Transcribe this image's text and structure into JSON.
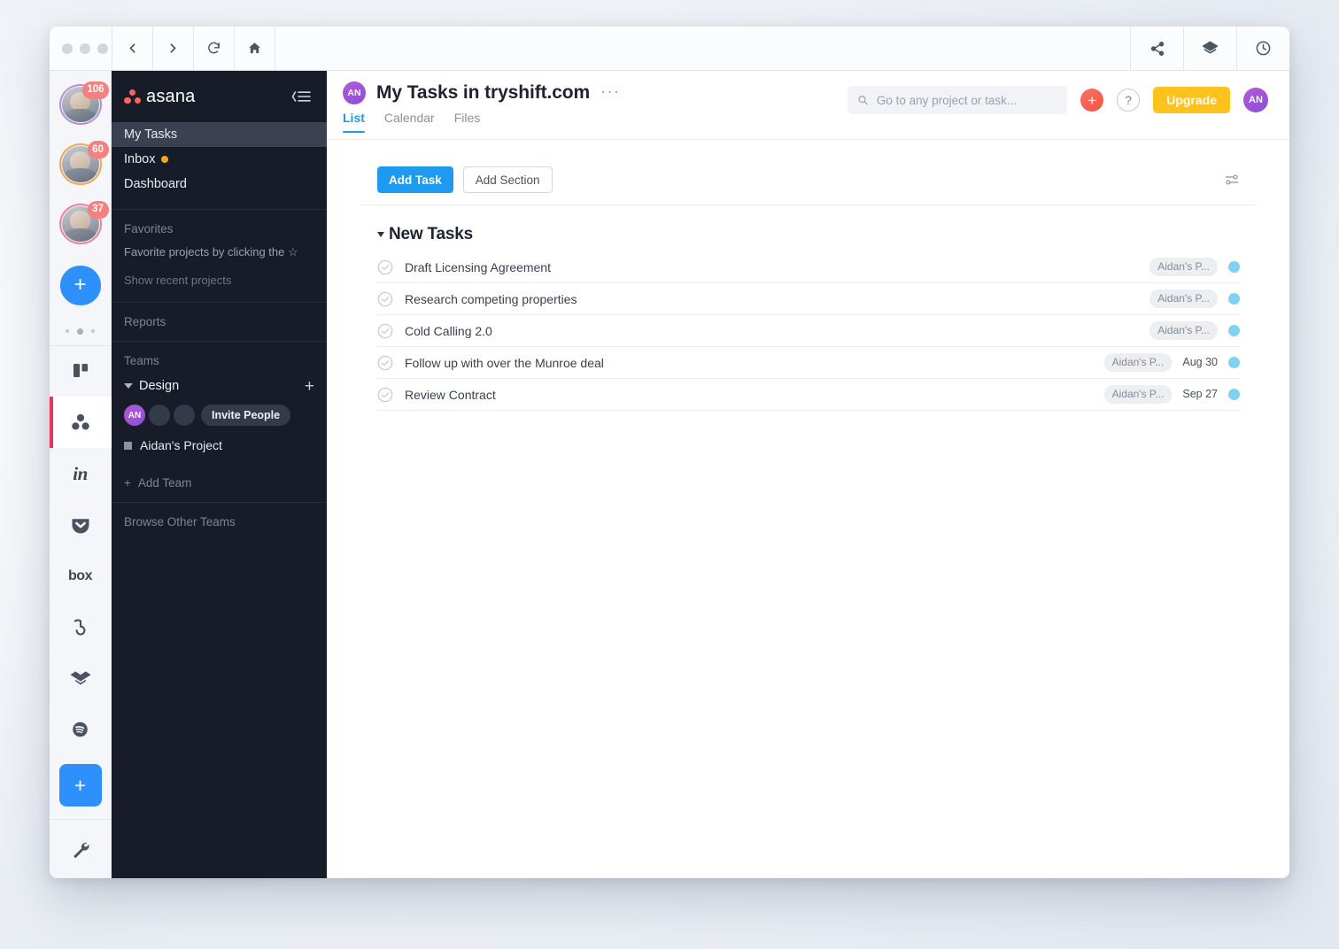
{
  "window": {
    "traffic_lights": [
      "close",
      "minimize",
      "maximize"
    ],
    "nav": [
      {
        "name": "back",
        "icon": "chevron-left-icon"
      },
      {
        "name": "forward",
        "icon": "chevron-right-icon"
      },
      {
        "name": "reload",
        "icon": "reload-icon"
      },
      {
        "name": "home",
        "icon": "home-icon"
      }
    ],
    "actions": [
      {
        "name": "share",
        "icon": "share-icon"
      },
      {
        "name": "layers",
        "icon": "layers-icon"
      },
      {
        "name": "history",
        "icon": "clock-icon"
      }
    ]
  },
  "rail": {
    "accounts": [
      {
        "badge": "106",
        "ring": "#b48fe0"
      },
      {
        "badge": "60",
        "ring": "#f0a85a"
      },
      {
        "badge": "37",
        "ring": "#ef7f9e"
      }
    ],
    "add_account_label": "+",
    "page_dots": 3,
    "apps": [
      {
        "name": "trello",
        "label": ""
      },
      {
        "name": "asana",
        "label": "",
        "active": true
      },
      {
        "name": "invision",
        "label": "in"
      },
      {
        "name": "pocket",
        "label": ""
      },
      {
        "name": "box",
        "label": "box"
      },
      {
        "name": "bitly",
        "label": ""
      },
      {
        "name": "dropbox",
        "label": ""
      },
      {
        "name": "spotify",
        "label": ""
      }
    ],
    "add_app_label": "+",
    "settings_icon": "wrench-icon"
  },
  "sidebar": {
    "logo_text": "asana",
    "collapse_icon": "collapse-menu-icon",
    "nav": [
      {
        "label": "My Tasks",
        "selected": true,
        "dot": false
      },
      {
        "label": "Inbox",
        "selected": false,
        "dot": true
      },
      {
        "label": "Dashboard",
        "selected": false,
        "dot": false
      }
    ],
    "favorites": {
      "caption": "Favorites",
      "empty_text": "Favorite projects by clicking the ",
      "star_glyph": "☆",
      "show_recent": "Show recent projects"
    },
    "reports_caption": "Reports",
    "teams": {
      "caption": "Teams",
      "team_name": "Design",
      "add_project_glyph": "+",
      "members": [
        {
          "initials": "AN",
          "me": true
        },
        {
          "initials": "",
          "me": false
        },
        {
          "initials": "",
          "me": false
        }
      ],
      "invite_label": "Invite People",
      "projects": [
        {
          "label": "Aidan's Project"
        }
      ],
      "add_team_label": "Add Team",
      "add_team_glyph": "+"
    },
    "browse_other_teams": "Browse Other Teams"
  },
  "header": {
    "project_avatar_initials": "AN",
    "title": "My Tasks in tryshift.com",
    "more_glyph": "···",
    "tabs": [
      {
        "label": "List",
        "active": true
      },
      {
        "label": "Calendar",
        "active": false
      },
      {
        "label": "Files",
        "active": false
      }
    ],
    "search": {
      "placeholder": "Go to any project or task...",
      "value": "",
      "icon": "search-icon"
    },
    "quick_add_glyph": "+",
    "help_glyph": "?",
    "upgrade_label": "Upgrade",
    "user_avatar_initials": "AN"
  },
  "toolbar": {
    "add_task_label": "Add Task",
    "add_section_label": "Add Section",
    "filter_icon": "sliders-icon"
  },
  "task_list": {
    "section_title": "New Tasks",
    "tasks": [
      {
        "title": "Draft Licensing Agreement",
        "project": "Aidan's P...",
        "due": "",
        "status_color": "#7fd2f5"
      },
      {
        "title": "Research competing properties",
        "project": "Aidan's P...",
        "due": "",
        "status_color": "#7fd2f5"
      },
      {
        "title": "Cold Calling 2.0",
        "project": "Aidan's P...",
        "due": "",
        "status_color": "#7fd2f5"
      },
      {
        "title": "Follow up with over the Munroe deal",
        "project": "Aidan's P...",
        "due": "Aug 30",
        "status_color": "#7fd2f5"
      },
      {
        "title": "Review Contract",
        "project": "Aidan's P...",
        "due": "Sep 27",
        "status_color": "#7fd2f5"
      }
    ]
  },
  "colors": {
    "accent_blue": "#1e9bf0",
    "sidebar_bg": "#171c28",
    "upgrade_yellow": "#ffc11b",
    "active_app_bar": "#e8325f",
    "asana_coral": "#f5685f"
  }
}
